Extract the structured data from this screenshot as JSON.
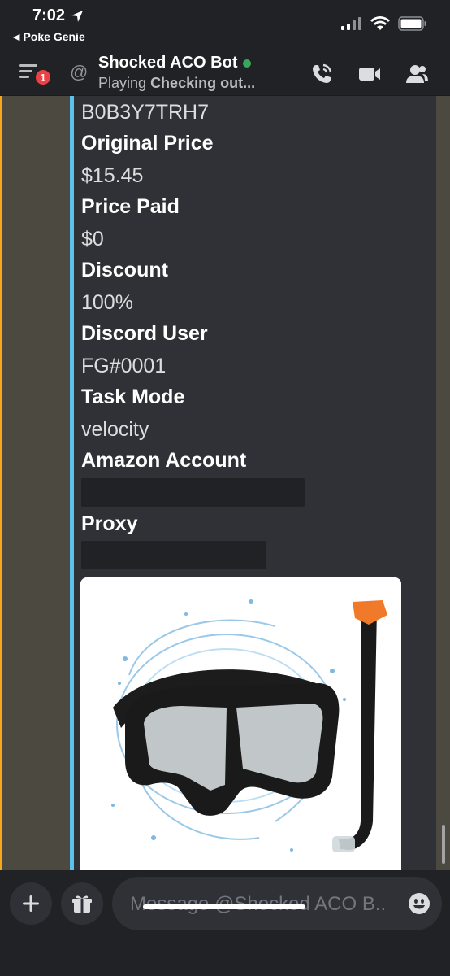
{
  "status_bar": {
    "time": "7:02",
    "back_app": "Poke Genie"
  },
  "header": {
    "badge_count": "1",
    "bot_name": "Shocked ACO Bot",
    "status_prefix": "Playing",
    "status_activity": "Checking out..."
  },
  "embed": {
    "partial_value": "B0B3Y7TRH7",
    "fields": [
      {
        "name": "Original Price",
        "value": "$15.45"
      },
      {
        "name": "Price Paid",
        "value": "$0"
      },
      {
        "name": "Discount",
        "value": "100%"
      },
      {
        "name": "Discord User",
        "value": "FG#0001"
      },
      {
        "name": "Task Mode",
        "value": "velocity"
      },
      {
        "name": "Amazon Account",
        "value": ""
      },
      {
        "name": "Proxy",
        "value": ""
      }
    ],
    "bar_color": "#5dc1ed"
  },
  "input": {
    "placeholder": "Message @Shocked ACO B.."
  },
  "colors": {
    "accent_orange": "#faa61a",
    "online": "#3ba55d",
    "badge": "#ed4245"
  }
}
